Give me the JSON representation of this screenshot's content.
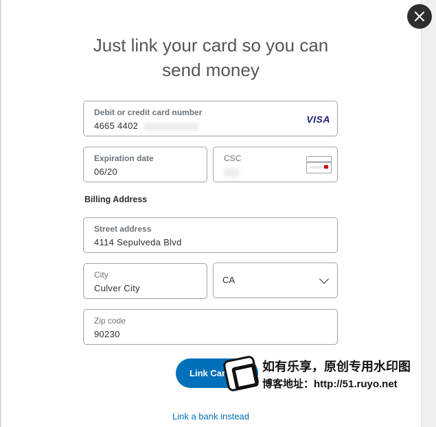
{
  "dialog": {
    "title": "Just link your card so you can\nsend money",
    "close_icon": "close-icon"
  },
  "card_number": {
    "label": "Debit or credit card number",
    "value": "4665 4402",
    "brand": "VISA"
  },
  "expiration": {
    "label": "Expiration date",
    "value": "06/20"
  },
  "csc": {
    "label": "CSC",
    "icon": "card-security-code-icon"
  },
  "billing": {
    "section_label": "Billing Address",
    "street": {
      "label": "Street address",
      "value": "4114 Sepulveda Blvd"
    },
    "city": {
      "label": "City",
      "value": "Culver City"
    },
    "state": {
      "value": "CA"
    },
    "zip": {
      "label": "Zip code",
      "value": "90230"
    }
  },
  "actions": {
    "primary_label": "Link Card",
    "secondary_link": "Link a bank instead"
  },
  "watermark": {
    "line1": "如有乐享，原创专用水印图",
    "line2": "博客地址：http://51.ruyo.net"
  },
  "colors": {
    "accent": "#0070ba",
    "close_button": "#2c2e2f",
    "visa_brand": "#1a1f71"
  }
}
